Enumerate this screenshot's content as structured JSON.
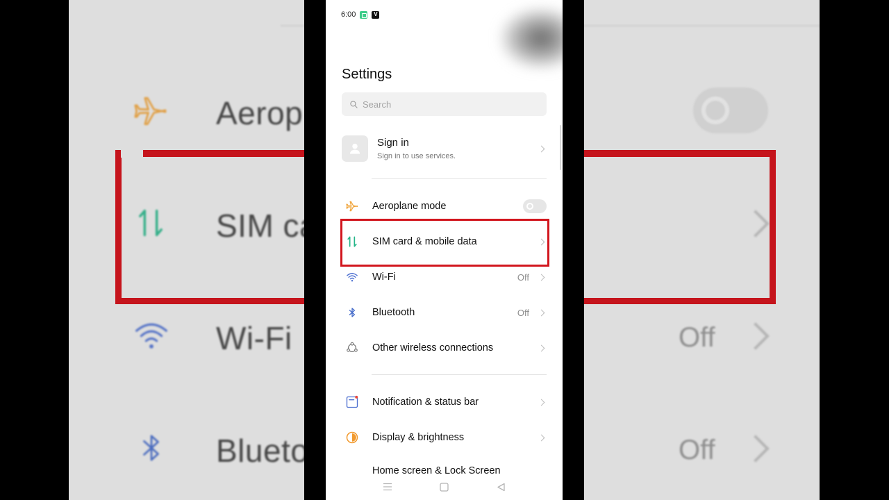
{
  "status_bar": {
    "time": "6:00",
    "app_badge_v": "V"
  },
  "page_title": "Settings",
  "search": {
    "placeholder": "Search"
  },
  "account": {
    "title": "Sign in",
    "subtitle": "Sign in to use services."
  },
  "group1": [
    {
      "label": "Aeroplane mode",
      "control": "toggle",
      "toggle_on": false,
      "icon": "airplane-icon"
    },
    {
      "label": "SIM card & mobile data",
      "value": "",
      "icon": "sim-data-icon",
      "highlighted": true
    },
    {
      "label": "Wi-Fi",
      "value": "Off",
      "icon": "wifi-icon"
    },
    {
      "label": "Bluetooth",
      "value": "Off",
      "icon": "bluetooth-icon"
    },
    {
      "label": "Other wireless connections",
      "value": "",
      "icon": "wireless-connections-icon"
    }
  ],
  "group2": [
    {
      "label": "Notification & status bar",
      "icon": "notification-icon"
    },
    {
      "label": "Display & brightness",
      "icon": "brightness-icon"
    },
    {
      "label": "Home screen & Lock Screen",
      "icon": "home-screen-icon"
    }
  ],
  "background_zoom": {
    "labels": [
      "Aerop",
      "SIM ca",
      "Wi-Fi",
      "Blueto"
    ],
    "values": [
      "Off",
      "Off"
    ]
  },
  "colors": {
    "highlight": "#d2161e",
    "airplane": "#f0a43a",
    "sim": "#25b589",
    "wifi": "#4c6fd1",
    "bluetooth": "#3f66c8",
    "brightness": "#f29a2e",
    "notification": "#4d6fd0"
  }
}
